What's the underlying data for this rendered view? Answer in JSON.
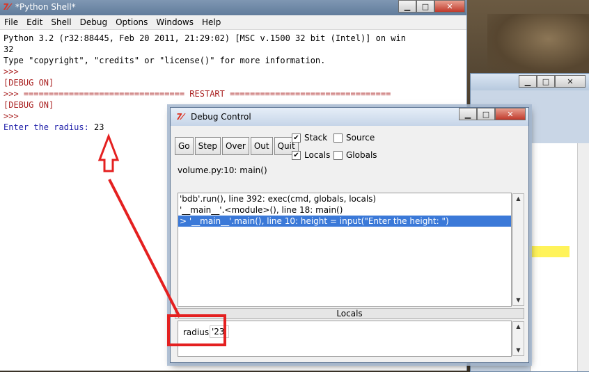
{
  "shell": {
    "title": "*Python Shell*",
    "menu": [
      "File",
      "Edit",
      "Shell",
      "Debug",
      "Options",
      "Windows",
      "Help"
    ],
    "lines": [
      {
        "text": "Python 3.2 (r32:88445, Feb 20 2011, 21:29:02) [MSC v.1500 32 bit (Intel)] on win",
        "color": "black"
      },
      {
        "text": "32",
        "color": "black"
      },
      {
        "text": "Type \"copyright\", \"credits\" or \"license()\" for more information.",
        "color": "black"
      },
      {
        "text": ">>> ",
        "color": "red"
      },
      {
        "text": "[DEBUG ON]",
        "color": "red"
      },
      {
        "text": ">>> ================================ RESTART ================================",
        "color": "red"
      },
      {
        "text": "[DEBUG ON]",
        "color": "red"
      },
      {
        "text": ">>> ",
        "color": "red"
      }
    ],
    "prompt_label": "Enter the radius: ",
    "prompt_value": "23"
  },
  "debug": {
    "title": "Debug Control",
    "buttons": [
      "Go",
      "Step",
      "Over",
      "Out",
      "Quit"
    ],
    "checkboxes": {
      "stack": {
        "label": "Stack",
        "checked": true
      },
      "source": {
        "label": "Source",
        "checked": false
      },
      "locals": {
        "label": "Locals",
        "checked": true
      },
      "globals": {
        "label": "Globals",
        "checked": false
      }
    },
    "status": "volume.py:10: main()",
    "stack_rows": [
      "'bdb'.run(), line 392: exec(cmd, globals, locals)",
      "'__main__'.<module>(), line 18: main()",
      "> '__main__'.main(), line 10: height = input(\"Enter the height: \")"
    ],
    "selected_row": 2,
    "locals_header": "Locals",
    "locals": {
      "name": "radius",
      "value": "'23'"
    }
  },
  "colors": {
    "shell_red": "#aa2222",
    "shell_blue": "#2222aa",
    "selection": "#3b79d8",
    "annotation": "#e42020",
    "highlight_yellow": "#fff35a"
  }
}
